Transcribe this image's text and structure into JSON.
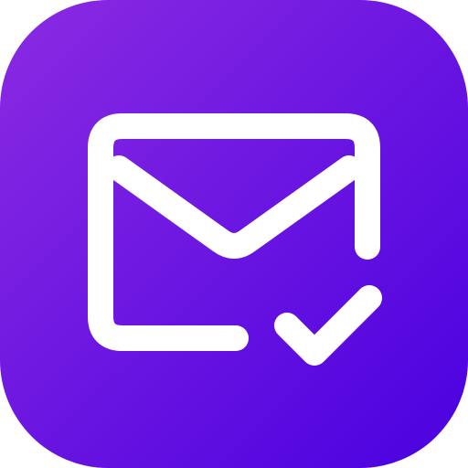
{
  "icon": {
    "name": "mail-check-icon",
    "meaning": "email verified",
    "gradient_start": "#8B2BE2",
    "gradient_end": "#4A00E0",
    "glyph_color": "#FFFFFF"
  }
}
